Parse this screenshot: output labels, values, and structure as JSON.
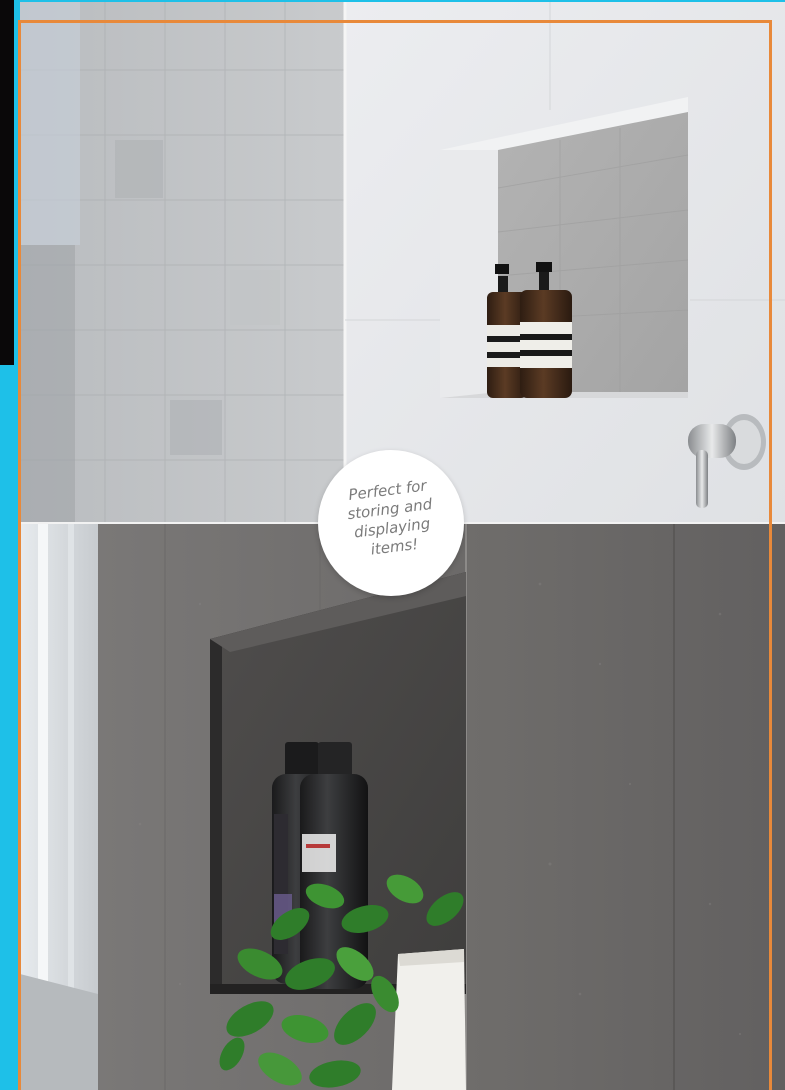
{
  "callout": {
    "text": "Perfect for storing and displaying items!"
  },
  "photos": {
    "top": {
      "subject": "white wall shower niche with two amber pump bottles and chrome mixer tap"
    },
    "bottom": {
      "subject": "dark stone tile shower niche with black bottles and green pothos plant"
    }
  },
  "colors": {
    "frame_orange": "#e8893a",
    "accent_cyan": "#1ec0e8",
    "left_black": "#0a0809",
    "bubble_text": "#7b7b7b"
  }
}
